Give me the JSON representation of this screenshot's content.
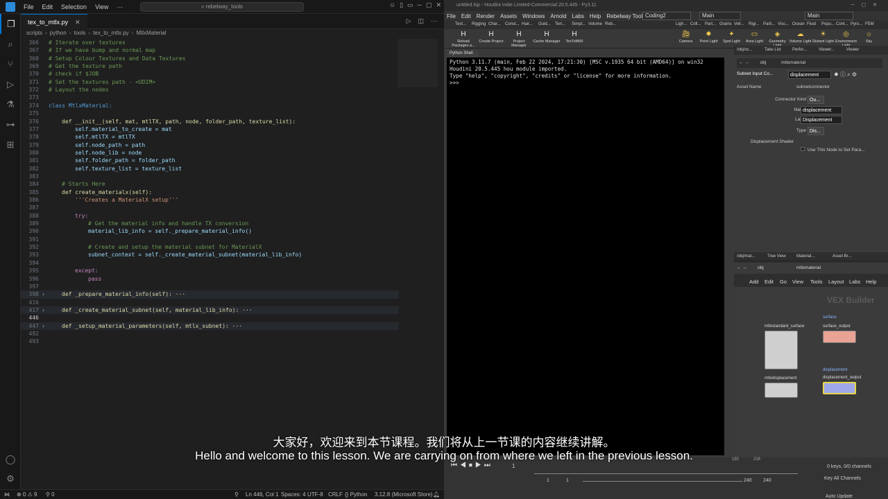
{
  "vscode": {
    "menu": [
      "File",
      "Edit",
      "Selection",
      "View"
    ],
    "search": "rebelway_tools",
    "tab": "tex_to_mtlx.py",
    "breadcrumb": [
      "scripts",
      "python",
      "tools",
      "tex_to_mtlx.py",
      "MtlxMaterial"
    ],
    "status": {
      "problems": "⊗ 0 ⚠ 9",
      "ports": "⚲ 0",
      "position": "Ln 446, Col 1",
      "spaces": "Spaces: 4",
      "encoding": "UTF-8",
      "eol": "CRLF",
      "language": "{} Python",
      "interpreter": "3.12.8 (Microsoft Store)"
    },
    "lines": [
      {
        "n": "366",
        "t": "# Iterate over textures",
        "c": "c-com",
        "i": 0
      },
      {
        "n": "367",
        "t": "# If we have bump and normal map",
        "c": "c-com",
        "i": 0
      },
      {
        "n": "368",
        "t": "# Setup Colour Textures and Data Textures",
        "c": "c-com",
        "i": 0
      },
      {
        "n": "369",
        "t": "# Get the texture path",
        "c": "c-com",
        "i": 0
      },
      {
        "n": "370",
        "t": "# check if $JOB",
        "c": "c-com",
        "i": 0
      },
      {
        "n": "371",
        "t": "# Set the textures path - <UDIM>",
        "c": "c-com",
        "i": 0
      },
      {
        "n": "372",
        "t": "# Layout the nodes",
        "c": "c-com",
        "i": 0
      },
      {
        "n": "373",
        "t": "",
        "c": "c-txt",
        "i": 0
      },
      {
        "n": "374",
        "t": "class MtlxMaterial:",
        "c": "c-kw",
        "i": 0
      },
      {
        "n": "375",
        "t": "",
        "c": "c-txt",
        "i": 0
      },
      {
        "n": "376",
        "t": "def __init__(self, mat, mtlTX, path, node, folder_path, texture_list):",
        "c": "c-fn",
        "i": 1
      },
      {
        "n": "377",
        "t": "self.material_to_create = mat",
        "c": "c-var",
        "i": 2
      },
      {
        "n": "378",
        "t": "self.mtlTX = mtlTX",
        "c": "c-var",
        "i": 2
      },
      {
        "n": "379",
        "t": "self.node_path = path",
        "c": "c-var",
        "i": 2
      },
      {
        "n": "380",
        "t": "self.node_lib = node",
        "c": "c-var",
        "i": 2
      },
      {
        "n": "381",
        "t": "self.folder_path = folder_path",
        "c": "c-var",
        "i": 2
      },
      {
        "n": "382",
        "t": "self.texture_list = texture_list",
        "c": "c-var",
        "i": 2
      },
      {
        "n": "383",
        "t": "",
        "c": "c-txt",
        "i": 0
      },
      {
        "n": "384",
        "t": "# Starts Here",
        "c": "c-com",
        "i": 1
      },
      {
        "n": "385",
        "t": "def create_materialx(self):",
        "c": "c-fn",
        "i": 1
      },
      {
        "n": "386",
        "t": "'''Creates a MaterialX setup'''",
        "c": "c-str",
        "i": 2
      },
      {
        "n": "387",
        "t": "",
        "c": "c-txt",
        "i": 0
      },
      {
        "n": "388",
        "t": "try:",
        "c": "c-ctl",
        "i": 2
      },
      {
        "n": "389",
        "t": "# Get the material info and handle TX conversion",
        "c": "c-com",
        "i": 3
      },
      {
        "n": "390",
        "t": "material_lib_info = self._prepare_material_info()",
        "c": "c-var",
        "i": 3
      },
      {
        "n": "391",
        "t": "",
        "c": "c-txt",
        "i": 0
      },
      {
        "n": "392",
        "t": "# Create and setup the material subnet for MaterialX",
        "c": "c-com",
        "i": 3
      },
      {
        "n": "393",
        "t": "subnet_context = self._create_material_subnet(material_lib_info)",
        "c": "c-var",
        "i": 3
      },
      {
        "n": "394",
        "t": "",
        "c": "c-txt",
        "i": 0
      },
      {
        "n": "395",
        "t": "except:",
        "c": "c-ctl",
        "i": 2
      },
      {
        "n": "396",
        "t": "pass",
        "c": "c-ctl",
        "i": 3
      },
      {
        "n": "397",
        "t": "",
        "c": "c-txt",
        "i": 0
      },
      {
        "n": "398",
        "t": "def _prepare_material_info(self): ···",
        "c": "c-fn",
        "i": 1,
        "fold": true
      },
      {
        "n": "416",
        "t": "",
        "c": "c-txt",
        "i": 0
      },
      {
        "n": "417",
        "t": "def _create_material_subnet(self, material_lib_info): ···",
        "c": "c-fn",
        "i": 1,
        "fold": true
      },
      {
        "n": "446",
        "t": "",
        "c": "c-txt",
        "i": 0,
        "cur": true
      },
      {
        "n": "447",
        "t": "def _setup_material_parameters(self, mtlx_subnet): ···",
        "c": "c-fn",
        "i": 1,
        "fold": true
      },
      {
        "n": "492",
        "t": "",
        "c": "c-txt",
        "i": 0
      },
      {
        "n": "493",
        "t": "",
        "c": "c-txt",
        "i": 0
      }
    ]
  },
  "houdini": {
    "title": "untitled.hip - Houdini Indie Limited-Commercial 20.5.445 - Py3.11",
    "menu": [
      "File",
      "Edit",
      "Render",
      "Assets",
      "Windows",
      "Arnold",
      "Labs",
      "Help",
      "Rebelway Tools"
    ],
    "desktop": "Coding2",
    "main1": "Main",
    "main2": "Main",
    "shelf_tabs": [
      "Text...",
      "Rigging",
      "Char...",
      "Const...",
      "Hair...",
      "Guid...",
      "Terr...",
      "Simpl...",
      "Volume",
      "Reb..."
    ],
    "shelf_tools": [
      "Reload Packages a...",
      "Create Project",
      "Project Manager",
      "Cache Manager",
      "TexToMtlX"
    ],
    "light_tabs": [
      "Ligh...",
      "Coll...",
      "Part...",
      "Grains",
      "Vell...",
      "Rigi...",
      "Parti...",
      "Visc...",
      "Ocean",
      "Fluid",
      "Popu...",
      "Cont...",
      "Pyro...",
      "FEM"
    ],
    "light_tools": [
      "Camera",
      "Point Light",
      "Spot Light",
      "Area Light",
      "Geometry Light",
      "Volume Light",
      "Distant Light",
      "Environment Light",
      "Sky"
    ],
    "pyshell_tab": "Python Shell",
    "pyshell": [
      "Python 3.11.7 (main, Feb 22 2024, 17:21:30) [MSC v.1935 64 bit (AMD64)] on win32",
      "Houdini 20.5.445 hou module imported.",
      "Type \"help\", \"copyright\", \"credits\" or \"license\" for more information.",
      ">>>"
    ],
    "param_tabs": [
      "/obj/oc...",
      "Take List",
      "Perfor...",
      "Viewer...",
      "Viewer"
    ],
    "param_path": [
      "obj",
      "mtlxmaterial"
    ],
    "param_node_type": "Subnet Input Co...",
    "param_node_name": "displacement",
    "param_asset_name": "Asset Name",
    "param_asset_value": "subnetconnector",
    "param_rows": [
      {
        "label": "Connector Kind",
        "value": "Ou..."
      },
      {
        "label": "Name",
        "value": "displacement"
      },
      {
        "label": "Label",
        "value": "Displacement"
      },
      {
        "label": "Type",
        "value": "Dis..."
      }
    ],
    "param_shader": "Displacement Shader",
    "param_checkbox": "Use This Node to Set Para...",
    "net_tabs": [
      "/obj/mat...",
      "Tree View",
      "Material...",
      "Asset Br..."
    ],
    "net_path": [
      "obj",
      "mtlxmaterial"
    ],
    "net_menu": [
      "Add",
      "Edit",
      "Go",
      "View",
      "Tools",
      "Layout",
      "Labs",
      "Help"
    ],
    "net_watermark": "VEX Builder",
    "nodes": {
      "standard_surface": "mtlxstandard_surface",
      "surface_title": "surface",
      "surface_output": "surface_output",
      "displacement": "mtlxdisplacement",
      "disp_title": "displacement",
      "disp_output": "displacement_output"
    },
    "timeline": {
      "frame": "1",
      "start": "1",
      "start2": "1",
      "end": "240",
      "end2": "240",
      "keys": "0 keys, 0/0 channels",
      "key_all": "Key All Channels",
      "auto_update": "Auto Update",
      "ticks": [
        "192",
        "216"
      ]
    }
  },
  "subtitles": {
    "cn": "大家好，欢迎来到本节课程。我们将从上一节课的内容继续讲解。",
    "en": "Hello and welcome to this lesson. We are carrying on from where we left in the previous lesson."
  },
  "colors": {
    "accent": "#0078d4",
    "houdini_bg": "#3a3a3a"
  }
}
